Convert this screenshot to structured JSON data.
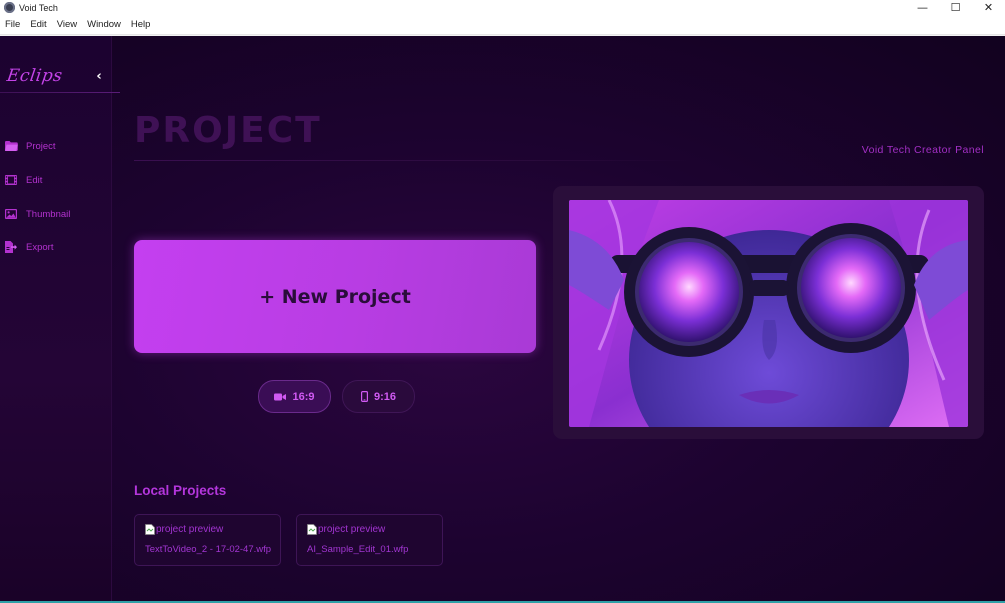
{
  "window": {
    "title": "Void Tech",
    "controls": {
      "minimize": "—",
      "maximize": "☐",
      "close": "✕"
    }
  },
  "menu": [
    "File",
    "Edit",
    "View",
    "Window",
    "Help"
  ],
  "sidebar": {
    "logo": "Eclips",
    "collapse_icon": "chevron-left-icon",
    "items": [
      {
        "label": "Project",
        "icon": "folder-icon"
      },
      {
        "label": "Edit",
        "icon": "film-icon"
      },
      {
        "label": "Thumbnail",
        "icon": "image-icon"
      },
      {
        "label": "Export",
        "icon": "export-file-icon"
      }
    ]
  },
  "header": {
    "title": "PROJECT",
    "panel_label": "Void Tech Creator Panel"
  },
  "new_project": {
    "label": "+ New Project"
  },
  "aspect_ratios": [
    {
      "label": "16:9",
      "icon": "video-camera-icon",
      "selected": true
    },
    {
      "label": "9:16",
      "icon": "mobile-phone-icon",
      "selected": false
    }
  ],
  "preview": {
    "description_icon": "preview-image"
  },
  "local_projects": {
    "title": "Local Projects",
    "items": [
      {
        "preview_alt": "project preview",
        "name": "TextToVideo_2 - 17-02-47.wfp"
      },
      {
        "preview_alt": "project preview",
        "name": "AI_Sample_Edit_01.wfp"
      }
    ]
  },
  "colors": {
    "accent": "#c443e8",
    "background": "#1d0330",
    "sidebar": "#220434",
    "button": "#c13ff0"
  }
}
